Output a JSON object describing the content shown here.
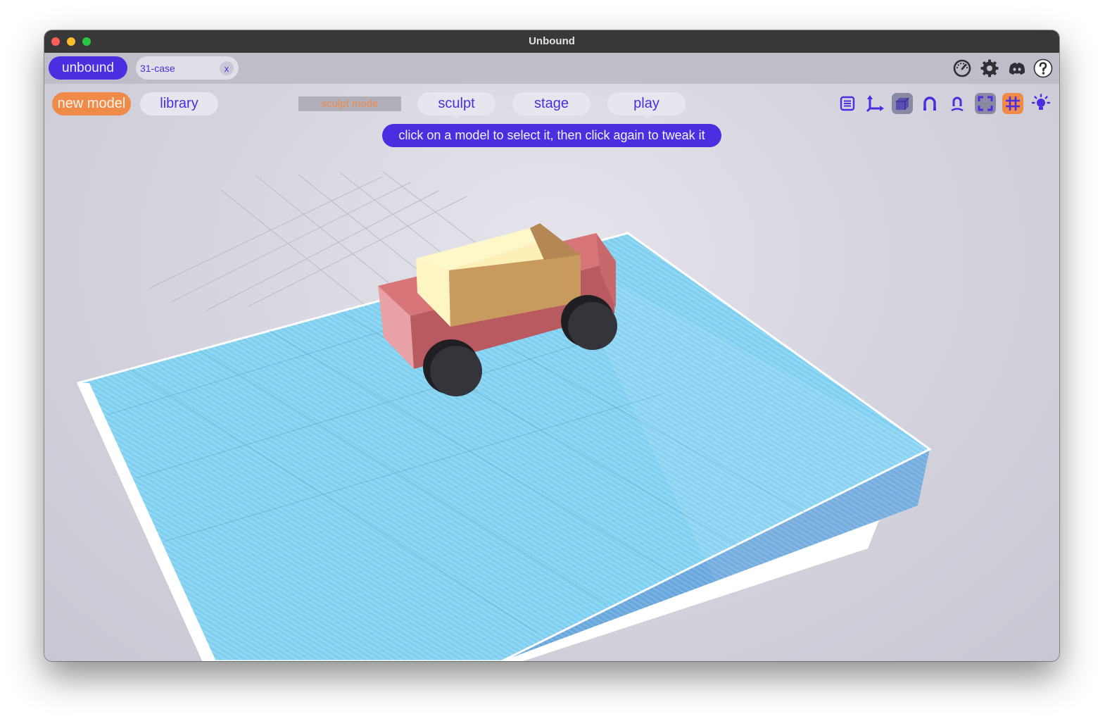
{
  "window": {
    "title": "Unbound"
  },
  "tabbar": {
    "app_label": "unbound",
    "document_tab": {
      "label": "31-case",
      "close_label": "x"
    },
    "icons": [
      "performance-gauge-icon",
      "gear-icon",
      "discord-icon",
      "help-icon"
    ]
  },
  "toolbar": {
    "new_model_label": "new model",
    "library_label": "library",
    "mode_label": "sculpt mode",
    "tabs": [
      {
        "label": "sculpt",
        "selected": true
      },
      {
        "label": "stage",
        "selected": false
      },
      {
        "label": "play",
        "selected": false
      }
    ],
    "tools": [
      {
        "icon": "list-panel-icon",
        "active": false
      },
      {
        "icon": "axes-icon",
        "active": false
      },
      {
        "icon": "solid-cube-icon",
        "active": true
      },
      {
        "icon": "magnet-icon",
        "active": false
      },
      {
        "icon": "magnet-user-icon",
        "active": false
      },
      {
        "icon": "frame-focus-icon",
        "active": true
      },
      {
        "icon": "grid-icon",
        "active": true
      },
      {
        "icon": "light-icon",
        "active": false
      }
    ]
  },
  "hint": {
    "text": "click on a model to select it, then click again to tweak it"
  },
  "colors": {
    "accent": "#4b2ee0",
    "orange": "#f08a48",
    "platform": "#7ccfee",
    "car_body": "#c65f64",
    "car_cabin": "#fdf5c2",
    "wheel": "#2f2f33"
  }
}
